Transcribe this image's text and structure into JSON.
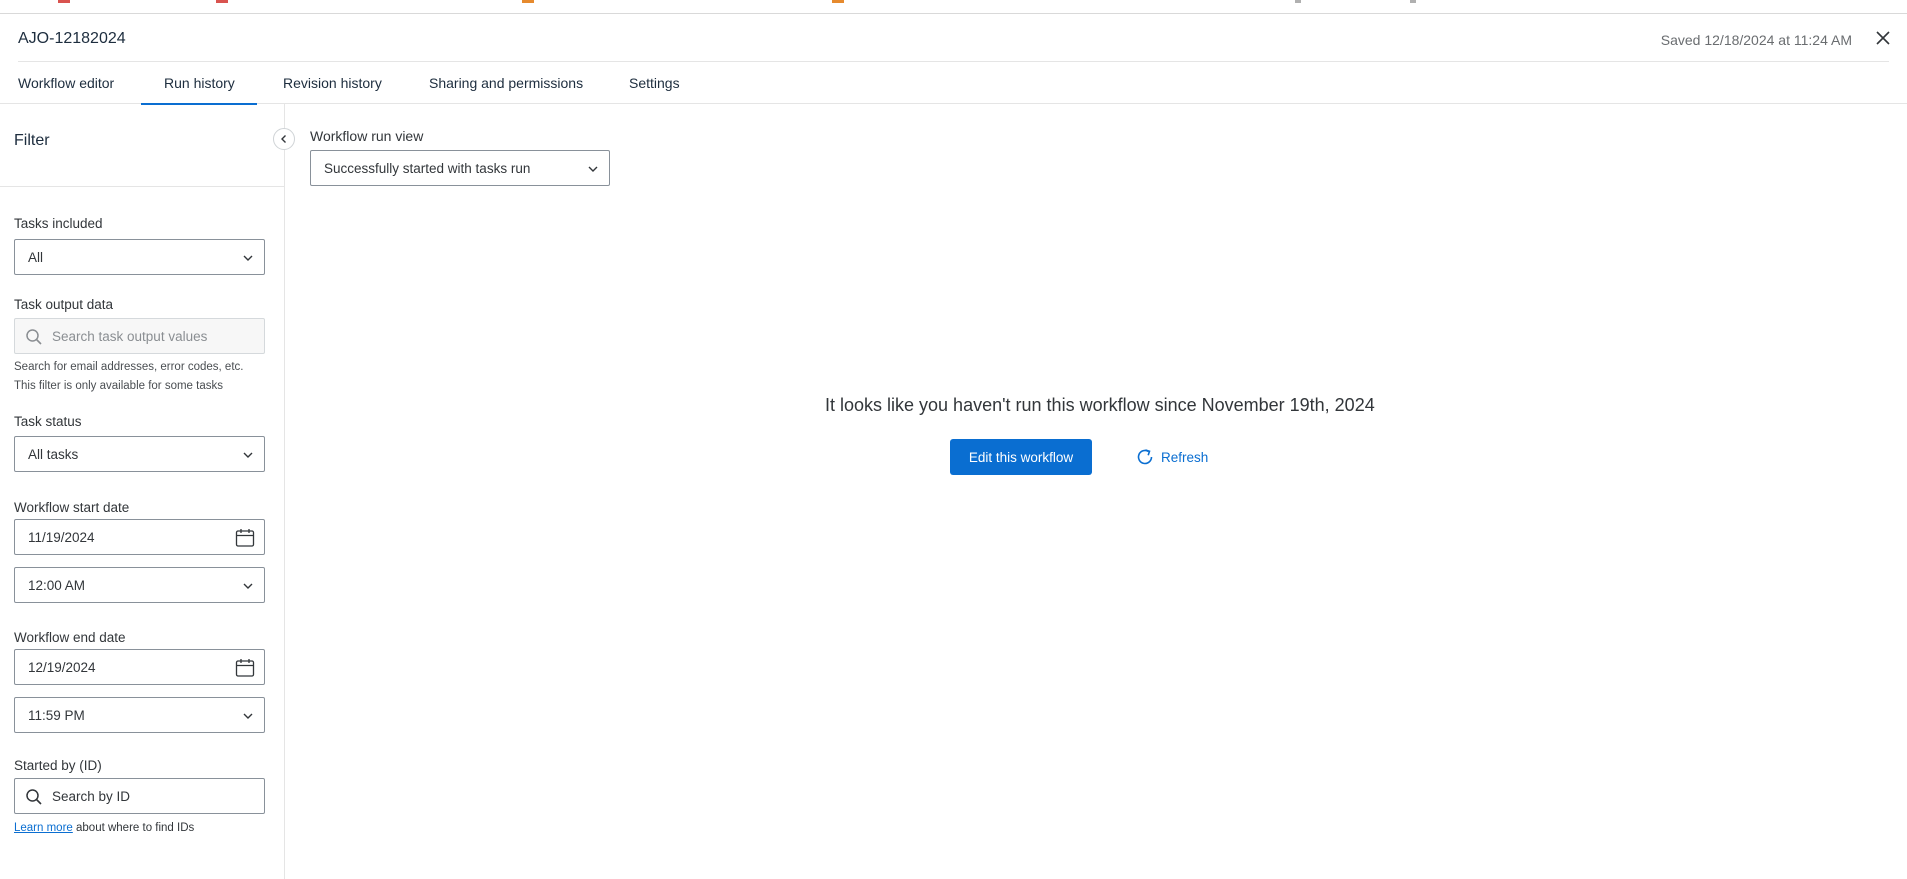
{
  "header": {
    "title": "AJO-12182024",
    "saved_status": "Saved 12/18/2024 at 11:24 AM"
  },
  "tabs": [
    {
      "label": "Workflow editor",
      "active": false
    },
    {
      "label": "Run history",
      "active": true
    },
    {
      "label": "Revision history",
      "active": false
    },
    {
      "label": "Sharing and permissions",
      "active": false
    },
    {
      "label": "Settings",
      "active": false
    }
  ],
  "filter": {
    "title": "Filter",
    "tasks_included": {
      "label": "Tasks included",
      "value": "All"
    },
    "task_output_data": {
      "label": "Task output data",
      "placeholder": "Search task output values",
      "help_line1": "Search for email addresses, error codes, etc.",
      "help_line2": "This filter is only available for some tasks"
    },
    "task_status": {
      "label": "Task status",
      "value": "All tasks"
    },
    "workflow_start_date": {
      "label": "Workflow start date",
      "date": "11/19/2024",
      "time": "12:00 AM"
    },
    "workflow_end_date": {
      "label": "Workflow end date",
      "date": "12/19/2024",
      "time": "11:59 PM"
    },
    "started_by": {
      "label": "Started by (ID)",
      "placeholder": "Search by ID",
      "learn_more": "Learn more",
      "learn_more_suffix": " about where to find IDs"
    }
  },
  "main": {
    "run_view_label": "Workflow run view",
    "run_view_value": "Successfully started with tasks run",
    "empty_message": "It looks like you haven't run this workflow since November 19th, 2024",
    "edit_button": "Edit this workflow",
    "refresh_button": "Refresh"
  },
  "colors": {
    "accent": "#0a6ed1",
    "text": "#32363a",
    "border": "#89919a"
  },
  "icons": [
    "close-icon",
    "chevron-left-icon",
    "chevron-down-icon",
    "search-icon",
    "calendar-icon",
    "refresh-icon"
  ]
}
